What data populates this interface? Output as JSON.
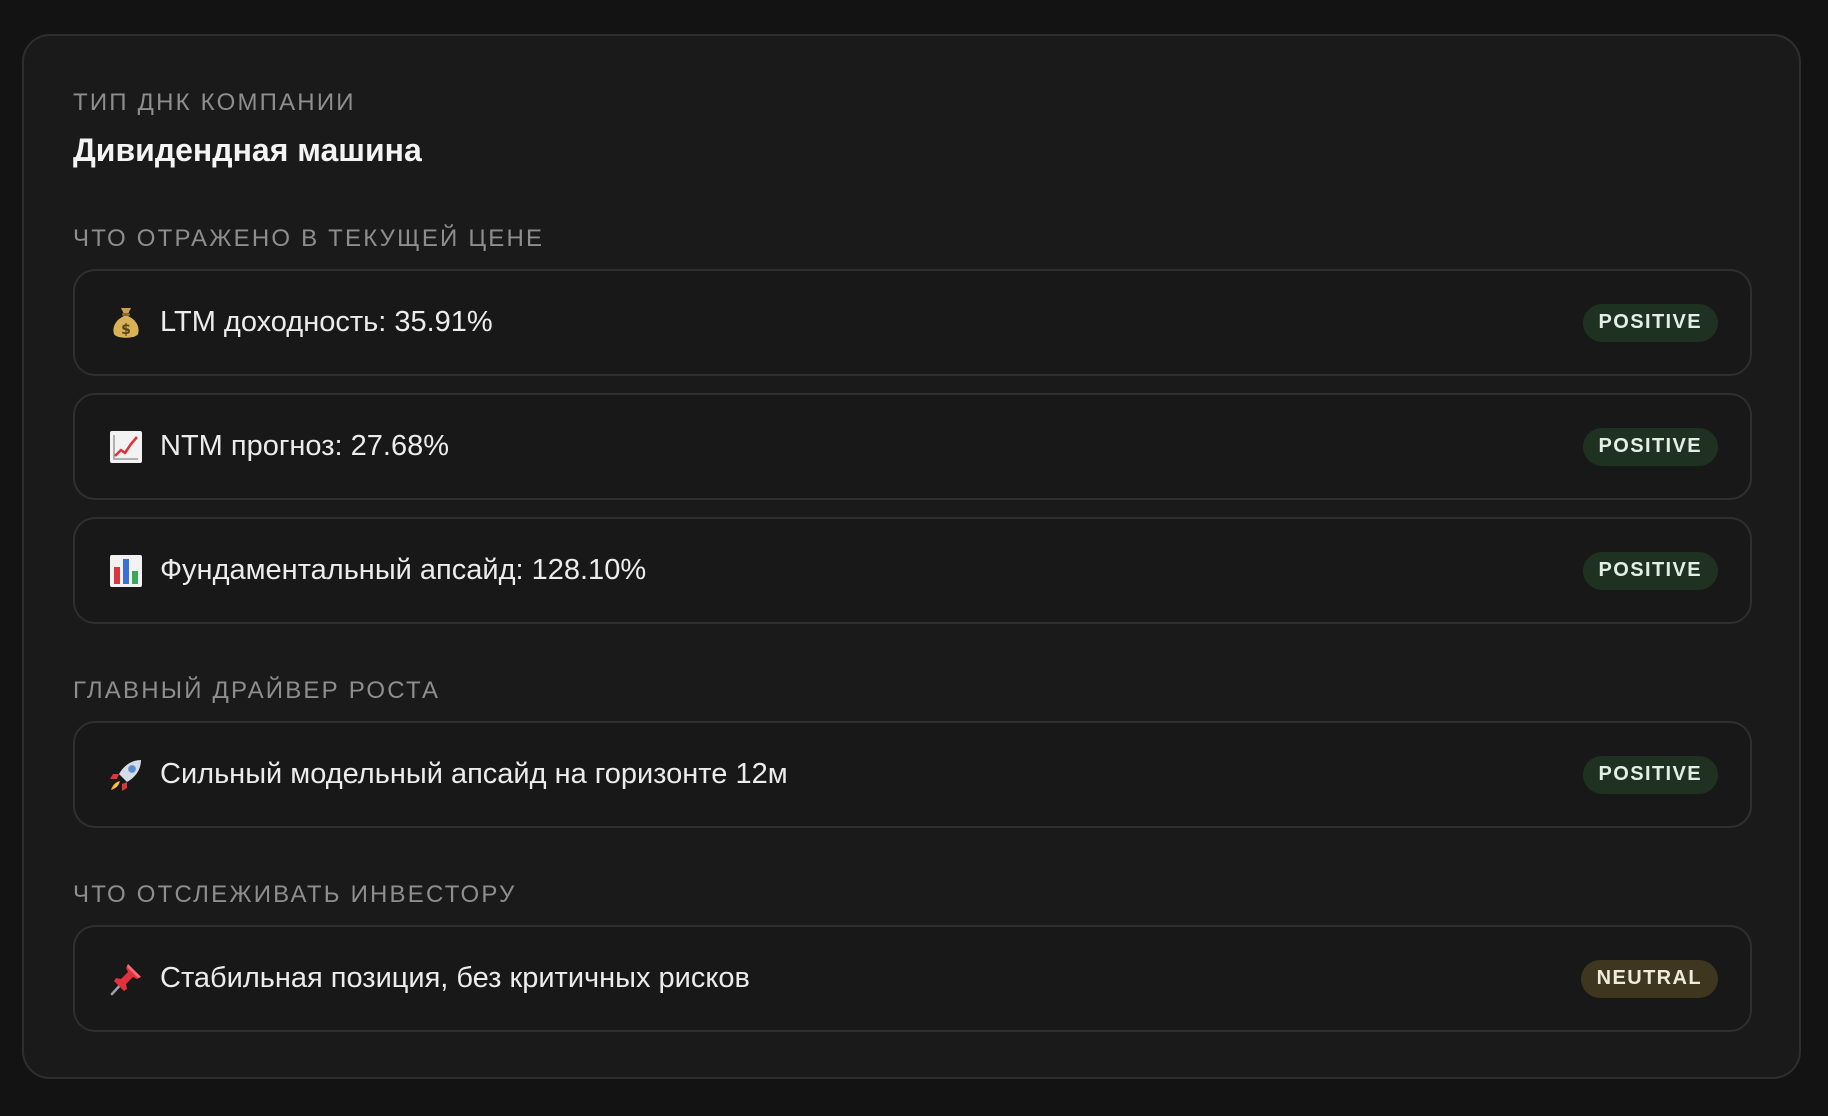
{
  "dna": {
    "label": "ТИП ДНК КОМПАНИИ",
    "title": "Дивидендная машина"
  },
  "priced_in": {
    "label": "ЧТО ОТРАЖЕНО В ТЕКУЩЕЙ ЦЕНЕ",
    "items": [
      {
        "icon": "money-bag-icon",
        "text": "LTM доходность: 35.91%",
        "badge": "POSITIVE"
      },
      {
        "icon": "chart-increasing-icon",
        "text": "NTM прогноз: 27.68%",
        "badge": "POSITIVE"
      },
      {
        "icon": "bar-chart-icon",
        "text": "Фундаментальный апсайд: 128.10%",
        "badge": "POSITIVE"
      }
    ]
  },
  "driver": {
    "label": "ГЛАВНЫЙ ДРАЙВЕР РОСТА",
    "items": [
      {
        "icon": "rocket-icon",
        "text": "Сильный модельный апсайд на горизонте 12м",
        "badge": "POSITIVE"
      }
    ]
  },
  "watch": {
    "label": "ЧТО ОТСЛЕЖИВАТЬ ИНВЕСТОРУ",
    "items": [
      {
        "icon": "pushpin-icon",
        "text": "Стабильная позиция, без критичных рисков",
        "badge": "NEUTRAL"
      }
    ]
  },
  "colors": {
    "positive_badge_bg": "#1f3222",
    "neutral_badge_bg": "#3f3620",
    "card_bg": "#1a1a1a",
    "page_bg": "#131313"
  }
}
